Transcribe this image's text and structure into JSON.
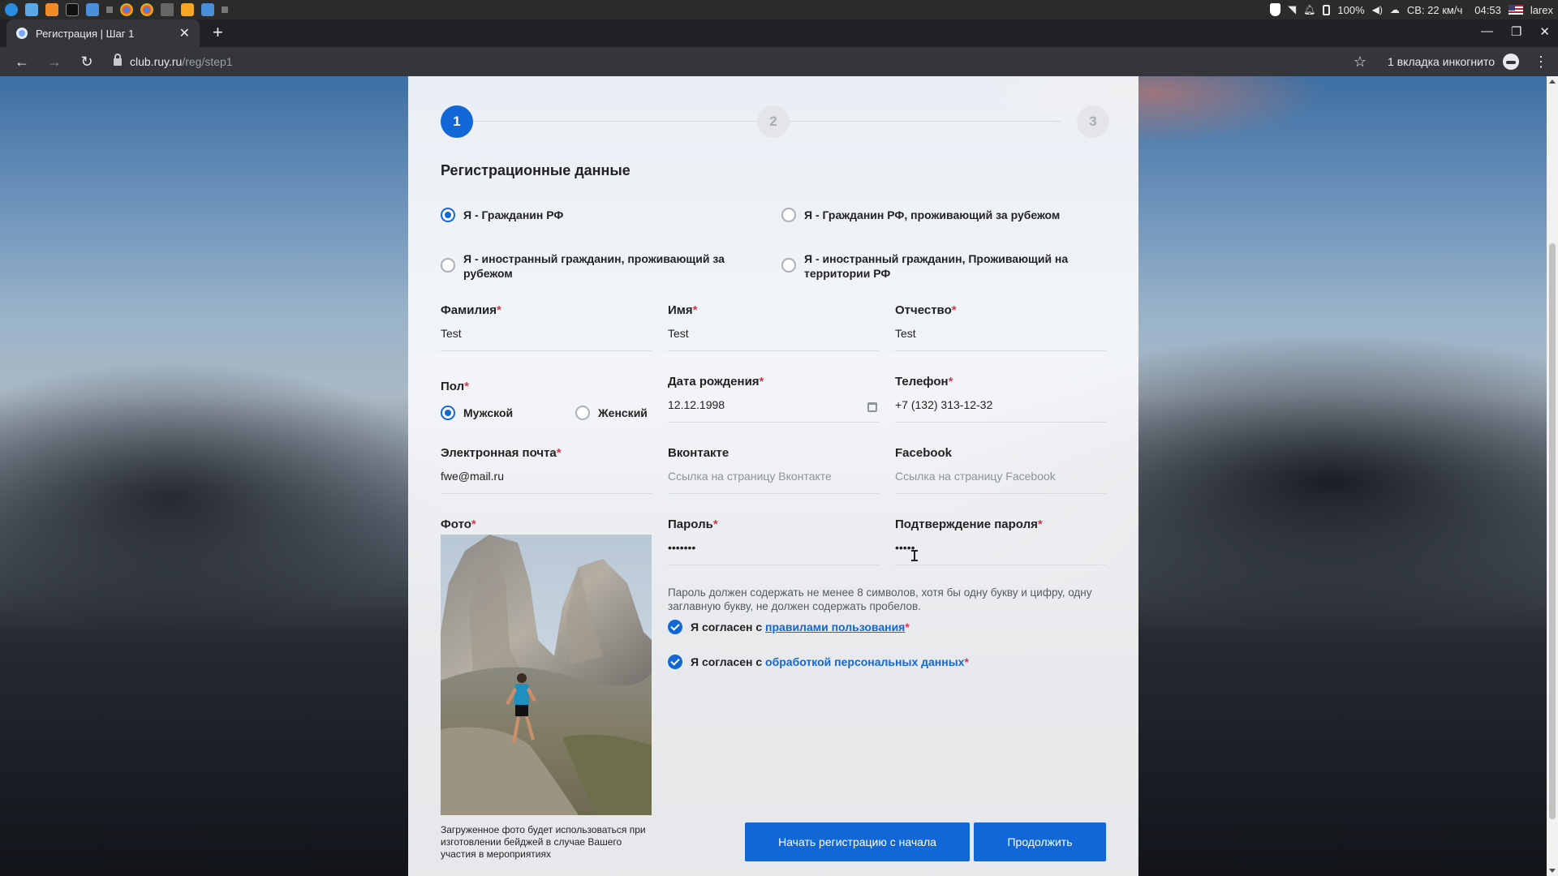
{
  "system": {
    "battery": "100%",
    "wind": "СВ: 22 км/ч",
    "time": "04:53",
    "user": "larex"
  },
  "browser": {
    "tab_title": "Регистрация | Шаг 1",
    "url_host": "club.ruy.ru",
    "url_path": "/reg/step1",
    "incognito_label": "1 вкладка инкогнито"
  },
  "stepper": {
    "steps": [
      "1",
      "2",
      "3"
    ],
    "active": 1
  },
  "form": {
    "section_title": "Регистрационные данные",
    "citizenship": [
      {
        "label": "Я - Гражданин РФ",
        "checked": true
      },
      {
        "label": "Я - Гражданин РФ, проживающий за рубежом",
        "checked": false
      },
      {
        "label": "Я - иностранный гражданин, проживающий за рубежом",
        "checked": false
      },
      {
        "label": "Я - иностранный гражданин, Проживающий на территории РФ",
        "checked": false
      }
    ],
    "required_mark": "*",
    "lastname": {
      "label": "Фамилия",
      "value": "Test"
    },
    "firstname": {
      "label": "Имя",
      "value": "Test"
    },
    "middlename": {
      "label": "Отчество",
      "value": "Test"
    },
    "gender": {
      "label": "Пол",
      "male": "Мужской",
      "female": "Женский",
      "selected": "male"
    },
    "birthdate": {
      "label": "Дата рождения",
      "value": "12.12.1998"
    },
    "phone": {
      "label": "Телефон",
      "value": "+7 (132) 313-12-32"
    },
    "email": {
      "label": "Электронная почта",
      "value": "fwe@mail.ru"
    },
    "vk": {
      "label": "Вконтакте",
      "placeholder": "Ссылка на страницу Вконтакте"
    },
    "facebook": {
      "label": "Facebook",
      "placeholder": "Ссылка на страницу Facebook"
    },
    "photo": {
      "label": "Фото",
      "note": "Загруженное фото будет использоваться при изготовлении бейджей в случае Вашего участия в мероприятиях"
    },
    "password": {
      "label": "Пароль",
      "value": "•••••••"
    },
    "password_confirm": {
      "label": "Подтверждение пароля",
      "value": "•••••"
    },
    "password_hint": "Пароль должен содержать не менее 8 символов, хотя бы одну букву и цифру, одну заглавную букву, не должен содержать пробелов.",
    "agree_rules": {
      "prefix": "Я согласен с",
      "link": "правилами пользования",
      "checked": true
    },
    "agree_data": {
      "prefix": "Я согласен с",
      "link": "обработкой персональных данных",
      "checked": true
    }
  },
  "buttons": {
    "restart": "Начать регистрацию с начала",
    "next": "Продолжить"
  },
  "colors": {
    "accent": "#1167d6",
    "required": "#e0334a"
  }
}
